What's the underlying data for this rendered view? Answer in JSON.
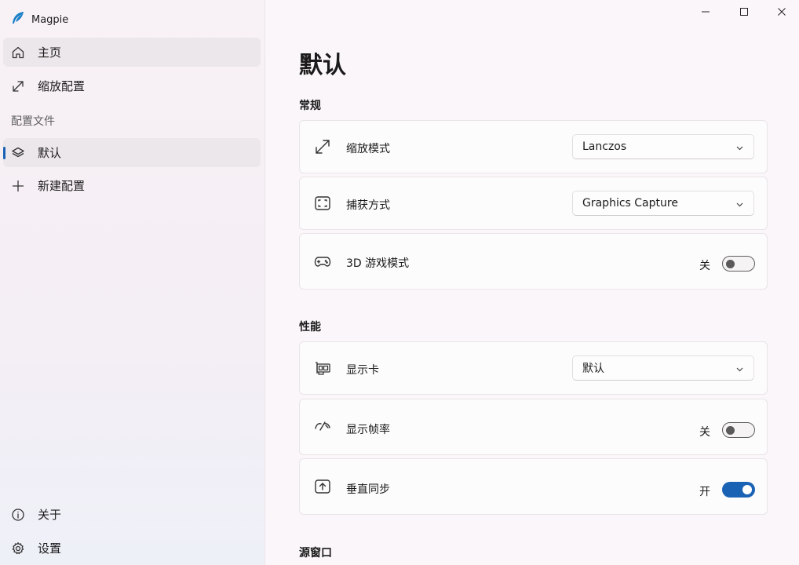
{
  "app": {
    "title": "Magpie"
  },
  "sidebar": {
    "items": [
      {
        "label": "主页",
        "icon": "home-icon"
      },
      {
        "label": "缩放配置",
        "icon": "scale-icon"
      }
    ],
    "section_label": "配置文件",
    "profiles": [
      {
        "label": "默认",
        "icon": "layers-icon",
        "active": true
      }
    ],
    "new_profile": {
      "label": "新建配置",
      "icon": "plus-icon"
    },
    "footer": [
      {
        "label": "关于",
        "icon": "info-icon"
      },
      {
        "label": "设置",
        "icon": "gear-icon"
      }
    ]
  },
  "page": {
    "title": "默认",
    "groups": [
      {
        "title": "常规",
        "settings": [
          {
            "label": "缩放模式",
            "icon": "scale-icon",
            "control": "dropdown",
            "value": "Lanczos"
          },
          {
            "label": "捕获方式",
            "icon": "capture-icon",
            "control": "dropdown",
            "value": "Graphics Capture"
          },
          {
            "label": "3D 游戏模式",
            "icon": "gamepad-icon",
            "control": "toggle",
            "state_text": "关",
            "on": false
          }
        ]
      },
      {
        "title": "性能",
        "settings": [
          {
            "label": "显示卡",
            "icon": "graphics-card-icon",
            "control": "dropdown",
            "value": "默认"
          },
          {
            "label": "显示帧率",
            "icon": "speedometer-icon",
            "control": "toggle",
            "state_text": "关",
            "on": false
          },
          {
            "label": "垂直同步",
            "icon": "vsync-icon",
            "control": "toggle",
            "state_text": "开",
            "on": true
          }
        ]
      },
      {
        "title": "源窗口"
      }
    ]
  },
  "colors": {
    "accent": "#1a63b4"
  }
}
